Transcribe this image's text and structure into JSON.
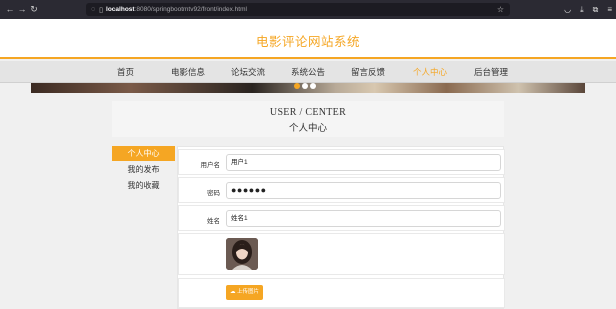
{
  "browser": {
    "url_host": "localhost",
    "url_path": ":8080/springbootmtv92/front/index.html"
  },
  "site": {
    "title": "电影评论网站系统"
  },
  "menu": {
    "items": [
      {
        "label": "首页"
      },
      {
        "label": "电影信息"
      },
      {
        "label": "论坛交流"
      },
      {
        "label": "系统公告"
      },
      {
        "label": "留言反馈"
      },
      {
        "label": "个人中心"
      },
      {
        "label": "后台管理"
      }
    ],
    "active_index": 5
  },
  "carousel": {
    "active_dot": 0,
    "dot_count": 3
  },
  "center": {
    "title_en": "USER / CENTER",
    "title_cn": "个人中心"
  },
  "sidebar": {
    "items": [
      {
        "label": "个人中心"
      },
      {
        "label": "我的发布"
      },
      {
        "label": "我的收藏"
      }
    ]
  },
  "form": {
    "username_label": "用户名",
    "username_value": "用户1",
    "password_label": "密码",
    "password_value": "●●●●●●",
    "name_label": "姓名",
    "name_value": "姓名1",
    "upload_label": "上传图片"
  },
  "colors": {
    "accent": "#f5a623"
  }
}
